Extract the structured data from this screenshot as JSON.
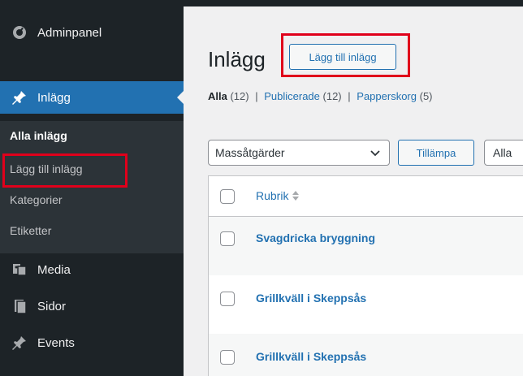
{
  "sidebar": {
    "menu": [
      {
        "label": "Adminpanel",
        "icon": "dashboard-icon"
      },
      {
        "label": "Inlägg",
        "icon": "pushpin-icon"
      },
      {
        "label": "Media",
        "icon": "media-icon"
      },
      {
        "label": "Sidor",
        "icon": "pages-icon"
      },
      {
        "label": "Events",
        "icon": "pushpin-icon"
      }
    ],
    "submenu": [
      {
        "label": "Alla inlägg"
      },
      {
        "label": "Lägg till inlägg"
      },
      {
        "label": "Kategorier"
      },
      {
        "label": "Etiketter"
      }
    ]
  },
  "main": {
    "title": "Inlägg",
    "add_button": "Lägg till inlägg",
    "filters": {
      "all": "Alla",
      "all_count": "(12)",
      "published": "Publicerade",
      "published_count": "(12)",
      "trash": "Papperskorg",
      "trash_count": "(5)"
    },
    "bulk_actions": {
      "selected": "Massåtgärder",
      "apply": "Tillämpa",
      "date_filter_partial": "Alla"
    },
    "table": {
      "column_title": "Rubrik",
      "rows": [
        {
          "title": "Svagdricka bryggning"
        },
        {
          "title": "Grillkväll i Skeppsås"
        },
        {
          "title": "Grillkväll i Skeppsås"
        }
      ]
    }
  },
  "colors": {
    "sidebar_bg": "#1d2327",
    "submenu_bg": "#2c3338",
    "accent": "#2271b1",
    "highlight_box": "#e0001b"
  }
}
